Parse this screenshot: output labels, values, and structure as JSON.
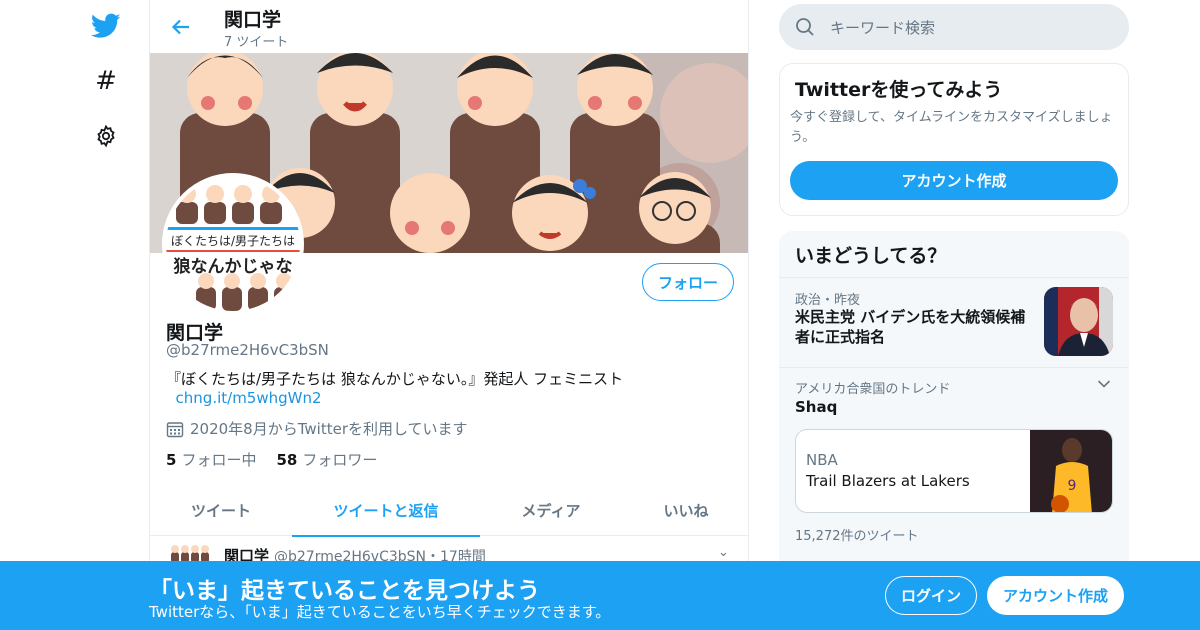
{
  "nav": {
    "icons": [
      "twitter-bird-icon",
      "hashtag-icon",
      "gear-icon"
    ],
    "hashtag_glyph": "#"
  },
  "header": {
    "title": "関口学",
    "subtitle": "7 ツイート"
  },
  "avatar": {
    "line1": "ぼくたちは/男子たちは",
    "line2": "狼なんかじゃな"
  },
  "profile": {
    "follow_label": "フォロー",
    "name": "関口学",
    "handle": "@b27rme2H6vC3bSN",
    "bio_text": "『ぼくたちは/男子たちは 狼なんかじゃない。』発起人 フェミニスト",
    "bio_link": "chng.it/m5whgWn2",
    "joined": "2020年8月からTwitterを利用しています",
    "following_count": "5",
    "following_label": "フォロー中",
    "followers_count": "58",
    "followers_label": "フォロワー"
  },
  "tabs": [
    {
      "label": "ツイート",
      "active": false
    },
    {
      "label": "ツイートと返信",
      "active": true
    },
    {
      "label": "メディア",
      "active": false
    },
    {
      "label": "いいね",
      "active": false
    }
  ],
  "tweet": {
    "name": "関口学",
    "handle_time": "@b27rme2H6vC3bSN・17時間",
    "chevron": "⌄"
  },
  "search": {
    "placeholder": "キーワード検索"
  },
  "signup_card": {
    "title": "Twitterを使ってみよう",
    "description": "今すぐ登録して、タイムラインをカスタマイズしましょう。",
    "button": "アカウント作成"
  },
  "whats_happening": {
    "title": "いまどうしてる？",
    "news": {
      "meta": "政治・昨夜",
      "headline": "米民主党 バイデン氏を大統領候補者に正式指名"
    },
    "trend": {
      "meta": "アメリカ合衆国のトレンド",
      "name": "Shaq",
      "card_label": "NBA",
      "card_title": "Trail Blazers at Lakers",
      "count": "15,272件のツイート"
    }
  },
  "bottom_bar": {
    "title": "「いま」起きていることを見つけよう",
    "subtitle": "Twitterなら、「いま」起きていることをいち早くチェックできます。",
    "login": "ログイン",
    "signup": "アカウント作成"
  },
  "colors": {
    "accent": "#1da1f2",
    "text": "#14171a",
    "muted": "#657786",
    "border": "#e6ecf0"
  }
}
